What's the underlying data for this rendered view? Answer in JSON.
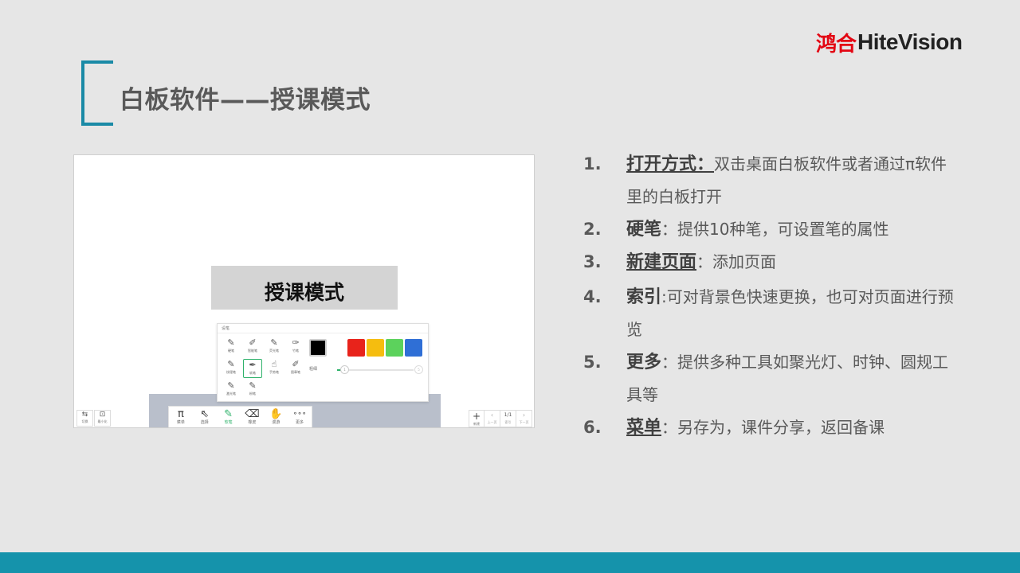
{
  "brand": {
    "name_cn": "鸿合",
    "name_en": "HiteVision",
    "color": "#e30613"
  },
  "slide_title": "白板软件——授课模式",
  "accent_color": "#1a8aa6",
  "screenshot": {
    "mode_label": "授课模式",
    "pen_panel": {
      "title": "设笔",
      "pens": [
        {
          "label": "硬笔",
          "icon": "pen-icon"
        },
        {
          "label": "智能笔",
          "icon": "smart-pen-icon"
        },
        {
          "label": "荧光笔",
          "icon": "highlighter-icon"
        },
        {
          "label": "竹笔",
          "icon": "bamboo-pen-icon"
        },
        {
          "label": "纹理笔",
          "icon": "texture-pen-icon"
        },
        {
          "label": "软笔",
          "icon": "brush-pen-icon"
        },
        {
          "label": "手势笔",
          "icon": "gesture-pen-icon"
        },
        {
          "label": "图章笔",
          "icon": "stamp-pen-icon"
        },
        {
          "label": "激光笔",
          "icon": "laser-pen-icon"
        },
        {
          "label": "粉笔",
          "icon": "chalk-icon"
        }
      ],
      "colors": [
        "#000000",
        "#ffffff",
        "#e8231b",
        "#f5bd0f",
        "#5cd25c",
        "#2f6fd6"
      ],
      "thickness_label": "粗细",
      "slider_min": "1",
      "slider_max": "5"
    },
    "toolbar": [
      {
        "label": "菜单",
        "glyph": "π",
        "icon": "pi-icon"
      },
      {
        "label": "选择",
        "glyph": "⇖",
        "icon": "cursor-icon"
      },
      {
        "label": "软笔",
        "glyph": "✎",
        "icon": "pen-icon"
      },
      {
        "label": "橡皮",
        "glyph": "⌫",
        "icon": "eraser-icon"
      },
      {
        "label": "漫游",
        "glyph": "✋",
        "icon": "hand-icon"
      },
      {
        "label": "更多",
        "glyph": "∘∘∘",
        "icon": "more-icon"
      }
    ],
    "left_buttons": [
      {
        "label": "切换",
        "glyph": "⇆",
        "icon": "switch-icon"
      },
      {
        "label": "最小化",
        "glyph": "⊡",
        "icon": "minimize-icon"
      }
    ],
    "pager": {
      "add_label": "新建",
      "prev_label": "上一页",
      "index_label": "索引",
      "next_label": "下一页",
      "page": "1/1"
    }
  },
  "features": [
    {
      "num": "1.",
      "keyword": "打开方式：",
      "underline": true,
      "text": "双击桌面白板软件或者通过π软件里的白板打开"
    },
    {
      "num": "2.",
      "keyword": "硬笔",
      "underline": false,
      "text": "：提供10种笔，可设置笔的属性"
    },
    {
      "num": "3.",
      "keyword": "新建页面",
      "underline": true,
      "text": "：添加页面"
    },
    {
      "num": "4.",
      "keyword": "索引",
      "underline": false,
      "text": ":可对背景色快速更换，也可对页面进行预览"
    },
    {
      "num": "5.",
      "keyword": "更多",
      "underline": false,
      "text": "：提供多种工具如聚光灯、时钟、圆规工具等"
    },
    {
      "num": "6.",
      "keyword": "菜单",
      "underline": true,
      "text": "：另存为，课件分享，返回备课"
    }
  ]
}
